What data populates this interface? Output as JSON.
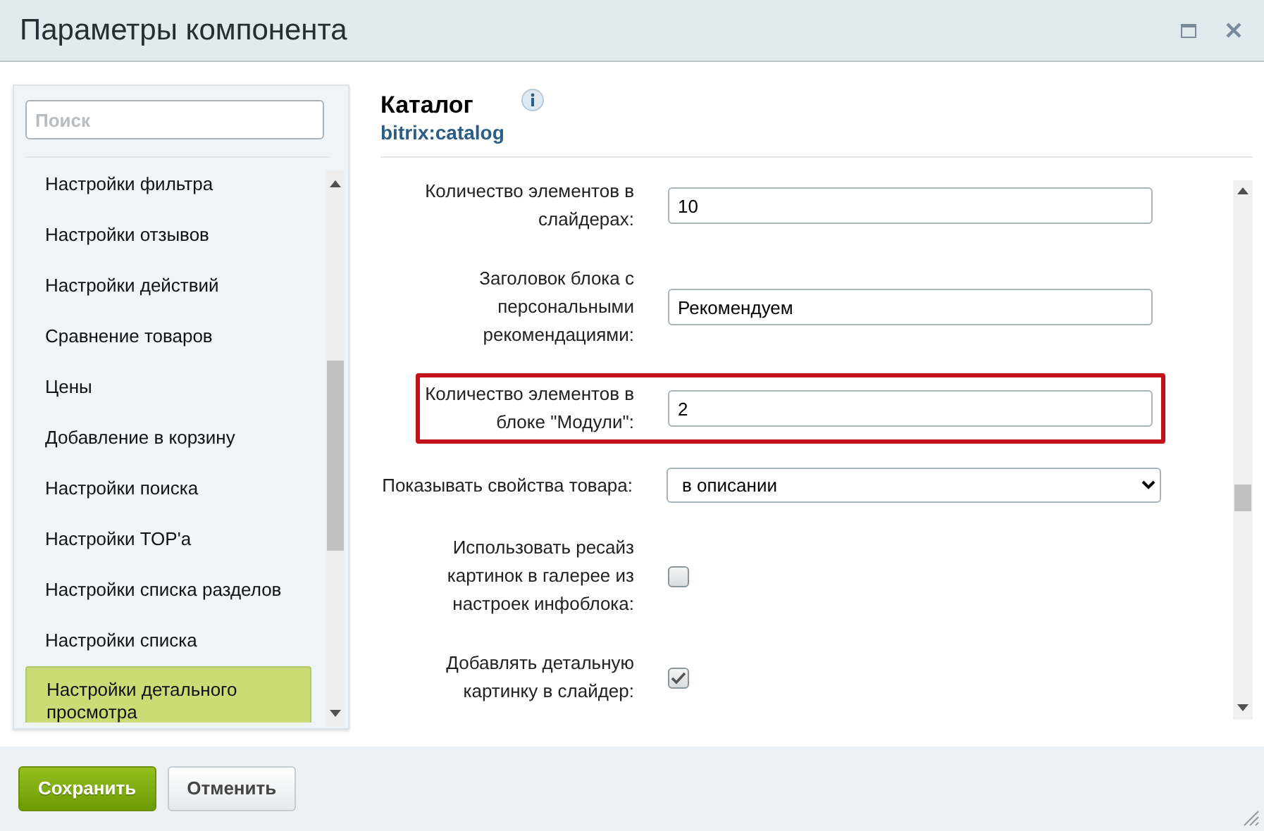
{
  "window": {
    "title": "Параметры компонента"
  },
  "sidebar": {
    "search": {
      "placeholder": "Поиск"
    },
    "items": [
      {
        "label": "Настройки фильтра",
        "selected": false
      },
      {
        "label": "Настройки отзывов",
        "selected": false
      },
      {
        "label": "Настройки действий",
        "selected": false
      },
      {
        "label": "Сравнение товаров",
        "selected": false
      },
      {
        "label": "Цены",
        "selected": false
      },
      {
        "label": "Добавление в корзину",
        "selected": false
      },
      {
        "label": "Настройки поиска",
        "selected": false
      },
      {
        "label": "Настройки TOP'а",
        "selected": false
      },
      {
        "label": "Настройки списка разделов",
        "selected": false
      },
      {
        "label": "Настройки списка",
        "selected": false
      },
      {
        "label": "Настройки детального просмотра",
        "selected": true
      }
    ]
  },
  "component": {
    "title": "Каталог",
    "code": "bitrix:catalog"
  },
  "params": [
    {
      "kind": "text",
      "label": "Количество элементов в слайдерах:",
      "value": "10",
      "highlighted": false
    },
    {
      "kind": "text",
      "label": "Заголовок блока с персональными рекомендациями:",
      "value": "Рекомендуем",
      "highlighted": false
    },
    {
      "kind": "text",
      "label": "Количество элементов в блоке \"Модули\":",
      "value": "2",
      "highlighted": true
    },
    {
      "kind": "select",
      "label": "Показывать свойства товара:",
      "value": "в описании",
      "highlighted": false
    },
    {
      "kind": "checkbox",
      "label": "Использовать ресайз картинок в галерее из настроек инфоблока:",
      "checked": false,
      "highlighted": false
    },
    {
      "kind": "checkbox",
      "label": "Добавлять детальную картинку в слайдер:",
      "checked": true,
      "highlighted": false
    }
  ],
  "buttons": [
    {
      "label": "Сохранить",
      "kind": "primary"
    },
    {
      "label": "Отменить",
      "kind": "secondary"
    }
  ]
}
